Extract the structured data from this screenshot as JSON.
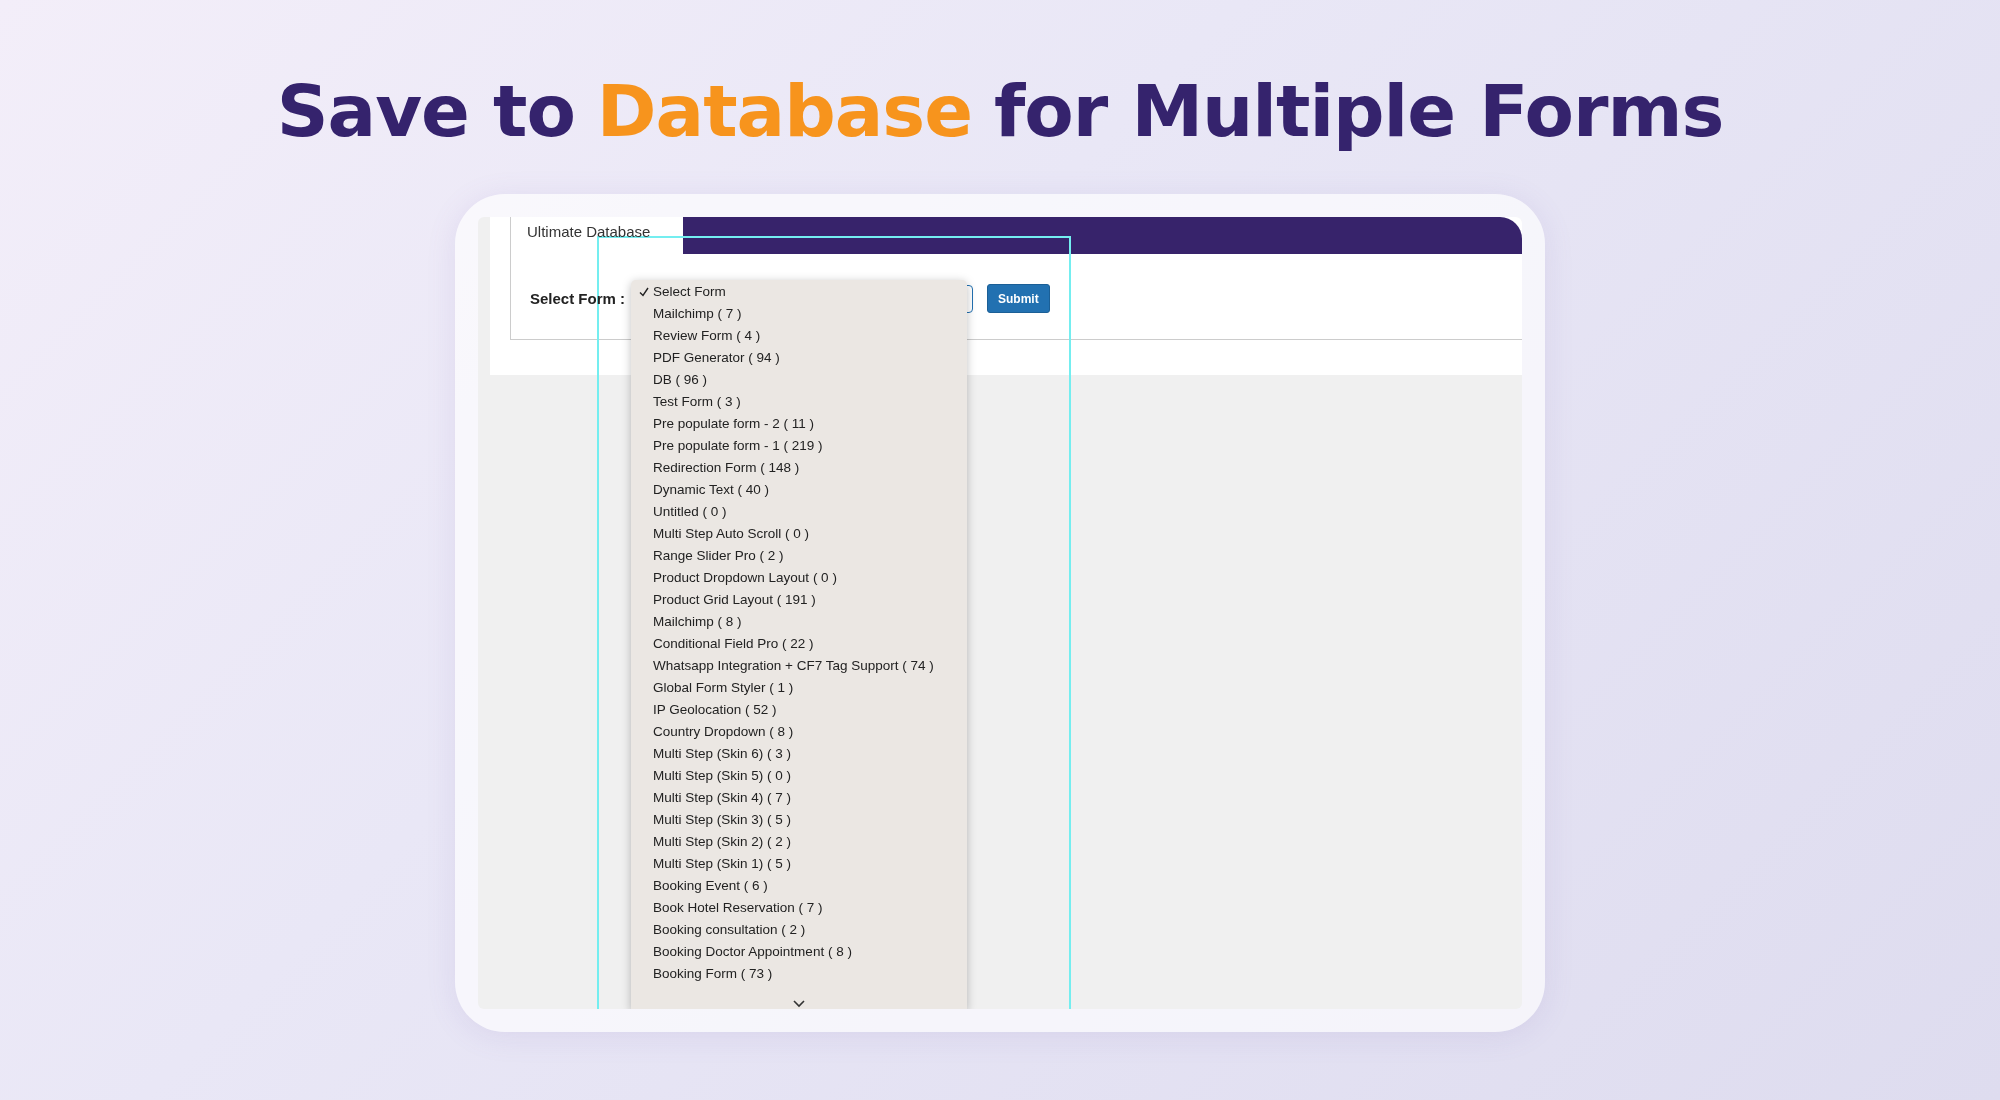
{
  "headline": {
    "parts": [
      {
        "text": "Save to",
        "accent": false
      },
      {
        "text": "Database",
        "accent": true
      },
      {
        "text": "for Multiple Forms",
        "accent": false
      }
    ]
  },
  "screen": {
    "tab": "Ultimate Database",
    "field_label": "Select Form :",
    "submit": "Submit",
    "options": [
      {
        "label": "Select Form",
        "selected": true
      },
      {
        "label": "Mailchimp ( 7 )",
        "selected": false
      },
      {
        "label": "Review Form ( 4 )",
        "selected": false
      },
      {
        "label": "PDF Generator ( 94 )",
        "selected": false
      },
      {
        "label": "DB ( 96 )",
        "selected": false
      },
      {
        "label": "Test Form ( 3 )",
        "selected": false
      },
      {
        "label": "Pre populate form - 2 ( 11 )",
        "selected": false
      },
      {
        "label": "Pre populate form - 1 ( 219 )",
        "selected": false
      },
      {
        "label": "Redirection Form ( 148 )",
        "selected": false
      },
      {
        "label": "Dynamic Text ( 40 )",
        "selected": false
      },
      {
        "label": "Untitled ( 0 )",
        "selected": false
      },
      {
        "label": "Multi Step Auto Scroll ( 0 )",
        "selected": false
      },
      {
        "label": "Range Slider Pro ( 2 )",
        "selected": false
      },
      {
        "label": "Product Dropdown Layout ( 0 )",
        "selected": false
      },
      {
        "label": "Product Grid Layout ( 191 )",
        "selected": false
      },
      {
        "label": "Mailchimp ( 8 )",
        "selected": false
      },
      {
        "label": "Conditional Field Pro ( 22 )",
        "selected": false
      },
      {
        "label": "Whatsapp Integration + CF7 Tag Support ( 74 )",
        "selected": false
      },
      {
        "label": "Global Form Styler ( 1 )",
        "selected": false
      },
      {
        "label": "IP Geolocation ( 52 )",
        "selected": false
      },
      {
        "label": "Country Dropdown ( 8 )",
        "selected": false
      },
      {
        "label": "Multi Step (Skin 6) ( 3 )",
        "selected": false
      },
      {
        "label": "Multi Step (Skin 5) ( 0 )",
        "selected": false
      },
      {
        "label": "Multi Step (Skin 4) ( 7 )",
        "selected": false
      },
      {
        "label": "Multi Step (Skin 3) ( 5 )",
        "selected": false
      },
      {
        "label": "Multi Step (Skin 2) ( 2 )",
        "selected": false
      },
      {
        "label": "Multi Step (Skin 1) ( 5 )",
        "selected": false
      },
      {
        "label": "Booking Event ( 6 )",
        "selected": false
      },
      {
        "label": "Book Hotel Reservation ( 7 )",
        "selected": false
      },
      {
        "label": "Booking consultation ( 2 )",
        "selected": false
      },
      {
        "label": "Booking Doctor Appointment ( 8 )",
        "selected": false
      },
      {
        "label": "Booking Form ( 73 )",
        "selected": false
      }
    ]
  }
}
